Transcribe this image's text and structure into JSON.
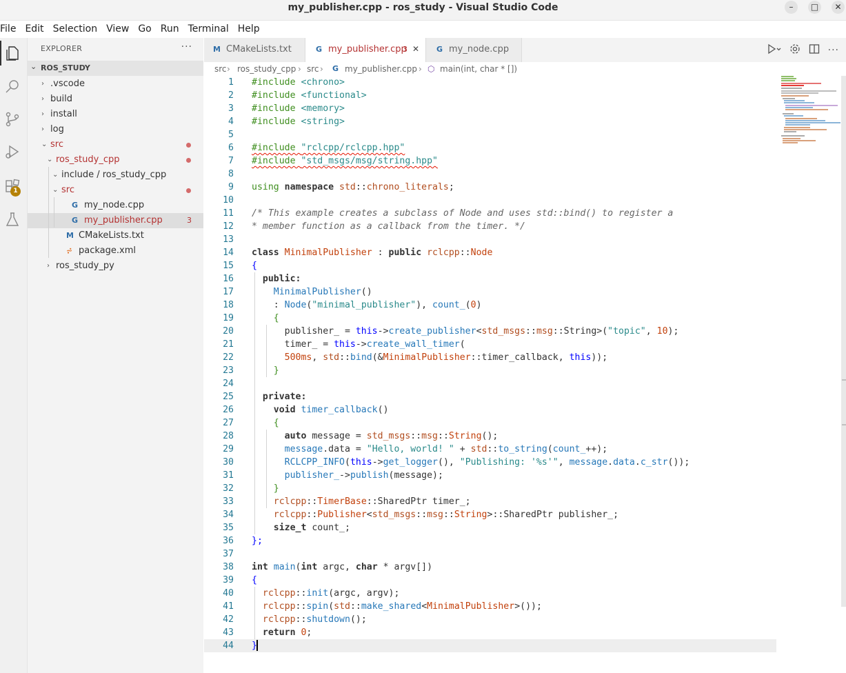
{
  "window": {
    "title": "my_publisher.cpp - ros_study - Visual Studio Code",
    "controls": [
      "–",
      "□",
      "✕"
    ]
  },
  "menu": [
    "File",
    "Edit",
    "Selection",
    "View",
    "Go",
    "Run",
    "Terminal",
    "Help"
  ],
  "activity_bar": {
    "items": [
      {
        "name": "explorer-icon",
        "active": true
      },
      {
        "name": "search-icon",
        "active": false
      },
      {
        "name": "source-control-icon",
        "active": false
      },
      {
        "name": "run-debug-icon",
        "active": false
      },
      {
        "name": "extensions-icon",
        "active": false,
        "badge": "1"
      },
      {
        "name": "testing-icon",
        "active": false
      }
    ]
  },
  "sidebar": {
    "header": "EXPLORER",
    "more": "···",
    "section": "ROS_STUDY",
    "tree": [
      {
        "label": ".vscode",
        "depth": 0,
        "chevron": "›",
        "kind": "folder"
      },
      {
        "label": "build",
        "depth": 0,
        "chevron": "›",
        "kind": "folder"
      },
      {
        "label": "install",
        "depth": 0,
        "chevron": "›",
        "kind": "folder"
      },
      {
        "label": "log",
        "depth": 0,
        "chevron": "›",
        "kind": "folder"
      },
      {
        "label": "src",
        "depth": 0,
        "chevron": "⌄",
        "kind": "folder",
        "red": true,
        "dot": true
      },
      {
        "label": "ros_study_cpp",
        "depth": 1,
        "chevron": "⌄",
        "kind": "folder",
        "red": true,
        "dot": true
      },
      {
        "label": "include / ros_study_cpp",
        "depth": 2,
        "chevron": "⌄",
        "kind": "folder"
      },
      {
        "label": "src",
        "depth": 2,
        "chevron": "⌄",
        "kind": "folder",
        "red": true,
        "dot": true
      },
      {
        "label": "my_node.cpp",
        "depth": 3,
        "icon": "G",
        "kind": "cpp"
      },
      {
        "label": "my_publisher.cpp",
        "depth": 3,
        "icon": "G",
        "kind": "cpp",
        "red": true,
        "selected": true,
        "count": "3"
      },
      {
        "label": "CMakeLists.txt",
        "depth": 2,
        "icon": "M",
        "kind": "cmake"
      },
      {
        "label": "package.xml",
        "depth": 2,
        "icon": "⩫",
        "kind": "xml"
      },
      {
        "label": "ros_study_py",
        "depth": 1,
        "chevron": "›",
        "kind": "folder"
      }
    ]
  },
  "tabs": [
    {
      "label": "CMakeLists.txt",
      "icon": "M",
      "active": false
    },
    {
      "label": "my_publisher.cpp",
      "icon": "G",
      "active": true,
      "count": "3",
      "close": "✕"
    },
    {
      "label": "my_node.cpp",
      "icon": "G",
      "active": false
    }
  ],
  "breadcrumb": [
    "src",
    "ros_study_cpp",
    "src",
    "my_publisher.cpp",
    "main(int, char * [])"
  ],
  "editor": {
    "current_line": 44,
    "lines": [
      [
        [
          "incl",
          "#include "
        ],
        [
          "str",
          "<chrono>"
        ]
      ],
      [
        [
          "incl",
          "#include "
        ],
        [
          "str",
          "<functional>"
        ]
      ],
      [
        [
          "incl",
          "#include "
        ],
        [
          "str",
          "<memory>"
        ]
      ],
      [
        [
          "incl",
          "#include "
        ],
        [
          "str",
          "<string>"
        ]
      ],
      [],
      [
        [
          "incl sq",
          "#include "
        ],
        [
          "str sq",
          "\"rclcpp/rclcpp.hpp\""
        ]
      ],
      [
        [
          "incl sq",
          "#include "
        ],
        [
          "str sq",
          "\"std_msgs/msg/string.hpp\""
        ]
      ],
      [],
      [
        [
          "incl",
          "using "
        ],
        [
          "kw2",
          "namespace "
        ],
        [
          "ns",
          "std"
        ],
        [
          "",
          "::"
        ],
        [
          "ns",
          "chrono_literals"
        ],
        [
          "",
          ";"
        ]
      ],
      [],
      [
        [
          "cmt",
          "/* This example creates a subclass of Node and uses std::bind() to register a"
        ]
      ],
      [
        [
          "cmt",
          "* member function as a callback from the timer. */"
        ]
      ],
      [],
      [
        [
          "kw2",
          "class "
        ],
        [
          "type",
          "MinimalPublisher"
        ],
        [
          "",
          " : "
        ],
        [
          "kw2",
          "public "
        ],
        [
          "ns",
          "rclcpp"
        ],
        [
          "",
          "::"
        ],
        [
          "type",
          "Node"
        ]
      ],
      [
        [
          "kw",
          "{"
        ]
      ],
      [
        [
          "",
          ""
        ],
        [
          "kw2",
          "  public:"
        ]
      ],
      [
        [
          "fn",
          "    MinimalPublisher"
        ],
        [
          "",
          "()"
        ]
      ],
      [
        [
          "",
          "    : "
        ],
        [
          "fn",
          "Node"
        ],
        [
          "",
          "("
        ],
        [
          "str",
          "\"minimal_publisher\""
        ],
        [
          "",
          "), "
        ],
        [
          "fn",
          "count_"
        ],
        [
          "",
          "("
        ],
        [
          "num",
          "0"
        ],
        [
          "",
          ")"
        ]
      ],
      [
        [
          "incl",
          "    {"
        ]
      ],
      [
        [
          "",
          "      publisher_ = "
        ],
        [
          "kw",
          "this"
        ],
        [
          "",
          "->"
        ],
        [
          "fn",
          "create_publisher"
        ],
        [
          "",
          "<"
        ],
        [
          "ns",
          "std_msgs"
        ],
        [
          "",
          "::"
        ],
        [
          "ns",
          "msg"
        ],
        [
          "",
          "::String>("
        ],
        [
          "str",
          "\"topic\""
        ],
        [
          "",
          ", "
        ],
        [
          "num",
          "10"
        ],
        [
          "",
          ");"
        ]
      ],
      [
        [
          "",
          "      timer_ = "
        ],
        [
          "kw",
          "this"
        ],
        [
          "",
          "->"
        ],
        [
          "fn",
          "create_wall_timer"
        ],
        [
          "",
          "("
        ]
      ],
      [
        [
          "num",
          "      500"
        ],
        [
          "type",
          "ms"
        ],
        [
          "",
          ", "
        ],
        [
          "ns",
          "std"
        ],
        [
          "",
          "::"
        ],
        [
          "fn",
          "bind"
        ],
        [
          "",
          "(&"
        ],
        [
          "type",
          "MinimalPublisher"
        ],
        [
          "",
          "::timer_callback, "
        ],
        [
          "kw",
          "this"
        ],
        [
          "",
          "));"
        ]
      ],
      [
        [
          "incl",
          "    }"
        ]
      ],
      [],
      [
        [
          "kw2",
          "  private:"
        ]
      ],
      [
        [
          "kw2",
          "    void "
        ],
        [
          "fn",
          "timer_callback"
        ],
        [
          "",
          "()"
        ]
      ],
      [
        [
          "incl",
          "    {"
        ]
      ],
      [
        [
          "kw2",
          "      auto "
        ],
        [
          "",
          "message = "
        ],
        [
          "ns",
          "std_msgs"
        ],
        [
          "",
          "::"
        ],
        [
          "ns",
          "msg"
        ],
        [
          "",
          "::"
        ],
        [
          "type",
          "String"
        ],
        [
          "",
          "();"
        ]
      ],
      [
        [
          "fn",
          "      message"
        ],
        [
          "",
          ".data = "
        ],
        [
          "str",
          "\"Hello, world! \""
        ],
        [
          "",
          " + "
        ],
        [
          "ns",
          "std"
        ],
        [
          "",
          "::"
        ],
        [
          "fn",
          "to_string"
        ],
        [
          "",
          "("
        ],
        [
          "fn",
          "count_"
        ],
        [
          "",
          "++);"
        ]
      ],
      [
        [
          "fn",
          "      RCLCPP_INFO"
        ],
        [
          "",
          "("
        ],
        [
          "kw",
          "this"
        ],
        [
          "",
          "->"
        ],
        [
          "fn",
          "get_logger"
        ],
        [
          "",
          "(), "
        ],
        [
          "str",
          "\"Publishing: '%s'\""
        ],
        [
          "",
          ", "
        ],
        [
          "fn",
          "message"
        ],
        [
          "",
          "."
        ],
        [
          "fn",
          "data"
        ],
        [
          "",
          "."
        ],
        [
          "fn",
          "c_str"
        ],
        [
          "",
          "());"
        ]
      ],
      [
        [
          "fn",
          "      publisher_"
        ],
        [
          "",
          "->"
        ],
        [
          "fn",
          "publish"
        ],
        [
          "",
          "(message);"
        ]
      ],
      [
        [
          "incl",
          "    }"
        ]
      ],
      [
        [
          "ns",
          "    rclcpp"
        ],
        [
          "",
          "::"
        ],
        [
          "type",
          "TimerBase"
        ],
        [
          "",
          "::SharedPtr timer_;"
        ]
      ],
      [
        [
          "ns",
          "    rclcpp"
        ],
        [
          "",
          "::"
        ],
        [
          "type",
          "Publisher"
        ],
        [
          "",
          "<"
        ],
        [
          "ns",
          "std_msgs"
        ],
        [
          "",
          "::"
        ],
        [
          "ns",
          "msg"
        ],
        [
          "",
          "::"
        ],
        [
          "type",
          "String"
        ],
        [
          "",
          ">::SharedPtr publisher_;"
        ]
      ],
      [
        [
          "kw2",
          "    size_t "
        ],
        [
          "",
          "count_;"
        ]
      ],
      [
        [
          "kw",
          "};"
        ]
      ],
      [],
      [
        [
          "kw2",
          "int "
        ],
        [
          "fn",
          "main"
        ],
        [
          "",
          "("
        ],
        [
          "kw2",
          "int "
        ],
        [
          "",
          "argc, "
        ],
        [
          "kw2",
          "char "
        ],
        [
          "",
          "* argv[])"
        ]
      ],
      [
        [
          "kw",
          "{"
        ]
      ],
      [
        [
          "ns",
          "  rclcpp"
        ],
        [
          "",
          "::"
        ],
        [
          "fn",
          "init"
        ],
        [
          "",
          "(argc, argv);"
        ]
      ],
      [
        [
          "ns",
          "  rclcpp"
        ],
        [
          "",
          "::"
        ],
        [
          "fn",
          "spin"
        ],
        [
          "",
          "("
        ],
        [
          "ns",
          "std"
        ],
        [
          "",
          "::"
        ],
        [
          "fn",
          "make_shared"
        ],
        [
          "",
          "<"
        ],
        [
          "type",
          "MinimalPublisher"
        ],
        [
          "",
          ">());"
        ]
      ],
      [
        [
          "ns",
          "  rclcpp"
        ],
        [
          "",
          "::"
        ],
        [
          "fn",
          "shutdown"
        ],
        [
          "",
          "();"
        ]
      ],
      [
        [
          "kw2",
          "  return "
        ],
        [
          "num",
          "0"
        ],
        [
          "",
          ";"
        ]
      ],
      [
        [
          "kw",
          "}"
        ]
      ]
    ]
  },
  "colors": {
    "accent": "#0078d4",
    "error": "#e51400",
    "badge": "#b58105",
    "modified": "#d46b6b"
  }
}
